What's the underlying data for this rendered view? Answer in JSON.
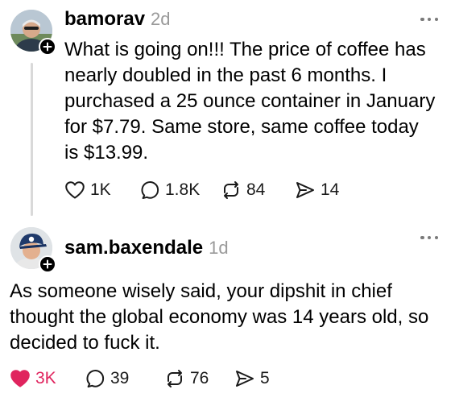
{
  "posts": [
    {
      "username": "bamorav",
      "time": "2d",
      "text_lines": [
        "What is going on!!! The price of coffee has",
        "nearly doubled in the past 6 months.  I",
        "purchased a 25 ounce container in January",
        "for $7.79.  Same store, same coffee today",
        "is $13.99."
      ],
      "actions": {
        "likes": "1K",
        "replies": "1.8K",
        "reposts": "84",
        "shares": "14"
      },
      "liked": false
    },
    {
      "username": "sam.baxendale",
      "time": "1d",
      "text_lines": [
        "As someone wisely said, your dipshit in chief",
        "thought the global economy was 14 years old, so",
        "decided to fuck it."
      ],
      "actions": {
        "likes": "3K",
        "replies": "39",
        "reposts": "76",
        "shares": "5"
      },
      "liked": true
    }
  ],
  "icons": {
    "heart": "heart-icon",
    "reply": "reply-icon",
    "repost": "repost-icon",
    "share": "share-icon",
    "more": "more-options-icon",
    "follow": "plus-icon"
  },
  "colors": {
    "like_active": "#e0245e",
    "muted_text": "#9a9a9a",
    "thread_line": "#d9d9d9"
  }
}
